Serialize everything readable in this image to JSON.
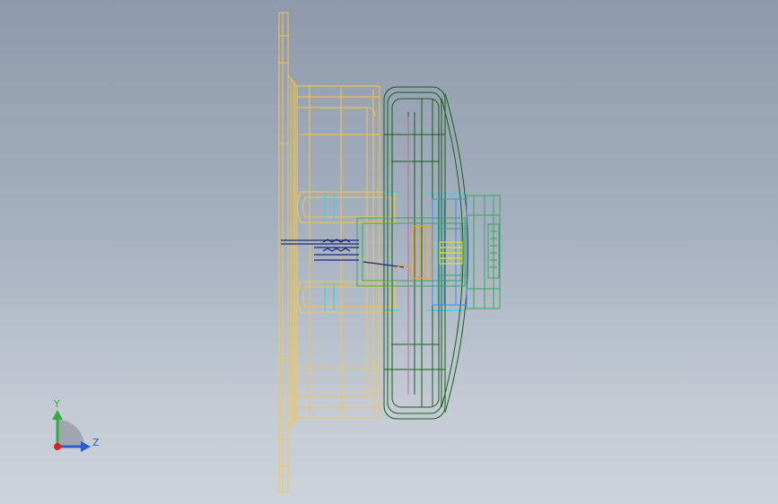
{
  "viewport": {
    "colors": {
      "background_top": "#8e9aab",
      "background_bottom": "#cdd3db",
      "housing_wireframe": "#f5c64a",
      "wheel_wireframe": "#1a5e1a",
      "hub_wireframe": "#3aa55a",
      "highlight_cyan": "#33d6e8",
      "shaft_blue": "#1a2a7a",
      "bearing_orange": "#f0a020",
      "nut_yellow": "#e6e030",
      "bore_blue": "#3a8ef0"
    }
  },
  "triad": {
    "y_label": "Y",
    "z_label": "Z",
    "icons": [
      "y-axis-arrow-icon",
      "z-axis-arrow-icon",
      "origin-dot-icon"
    ]
  }
}
